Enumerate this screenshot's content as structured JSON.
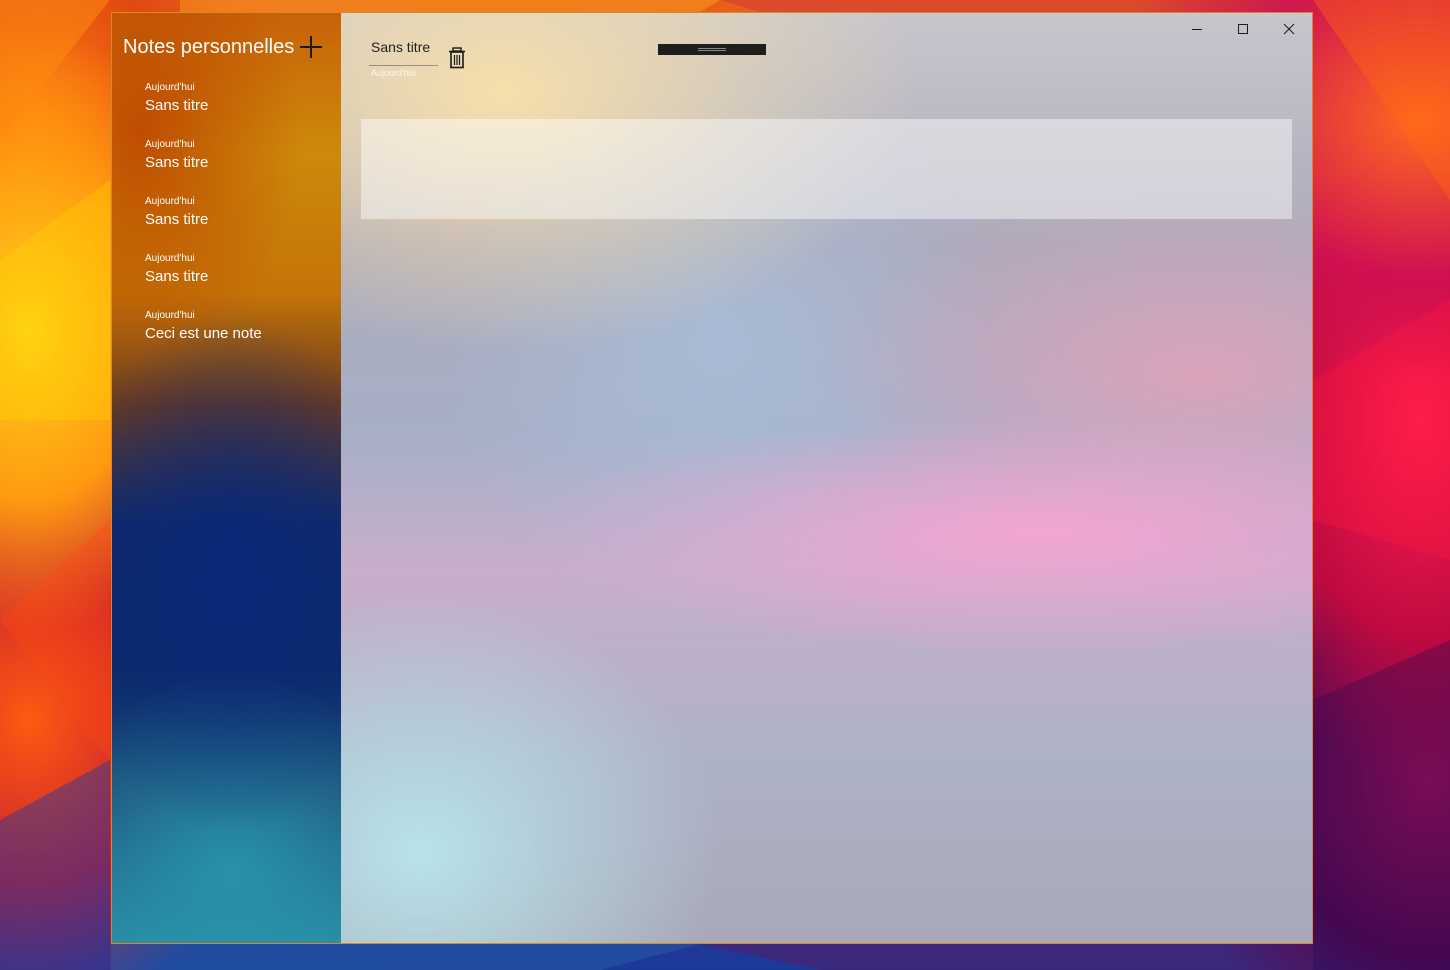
{
  "app": {
    "title": "Notes personnelles"
  },
  "sidebar": {
    "title": "Notes personnelles",
    "notes": [
      {
        "date": "Aujourd'hui",
        "title": "Sans titre"
      },
      {
        "date": "Aujourd'hui",
        "title": "Sans titre"
      },
      {
        "date": "Aujourd'hui",
        "title": "Sans titre"
      },
      {
        "date": "Aujourd'hui",
        "title": "Sans titre"
      },
      {
        "date": "Aujourd'hui",
        "title": "Ceci est une note"
      }
    ]
  },
  "editor": {
    "title_value": "Sans titre",
    "date": "Aujourd'hui",
    "body_value": ""
  },
  "icons": {
    "add": "plus-icon",
    "delete": "trash-icon",
    "minimize": "minimize-icon",
    "maximize": "maximize-icon",
    "close": "close-icon"
  },
  "colors": {
    "window_border": "#d88a2a",
    "handle": "#1e1e1e"
  }
}
